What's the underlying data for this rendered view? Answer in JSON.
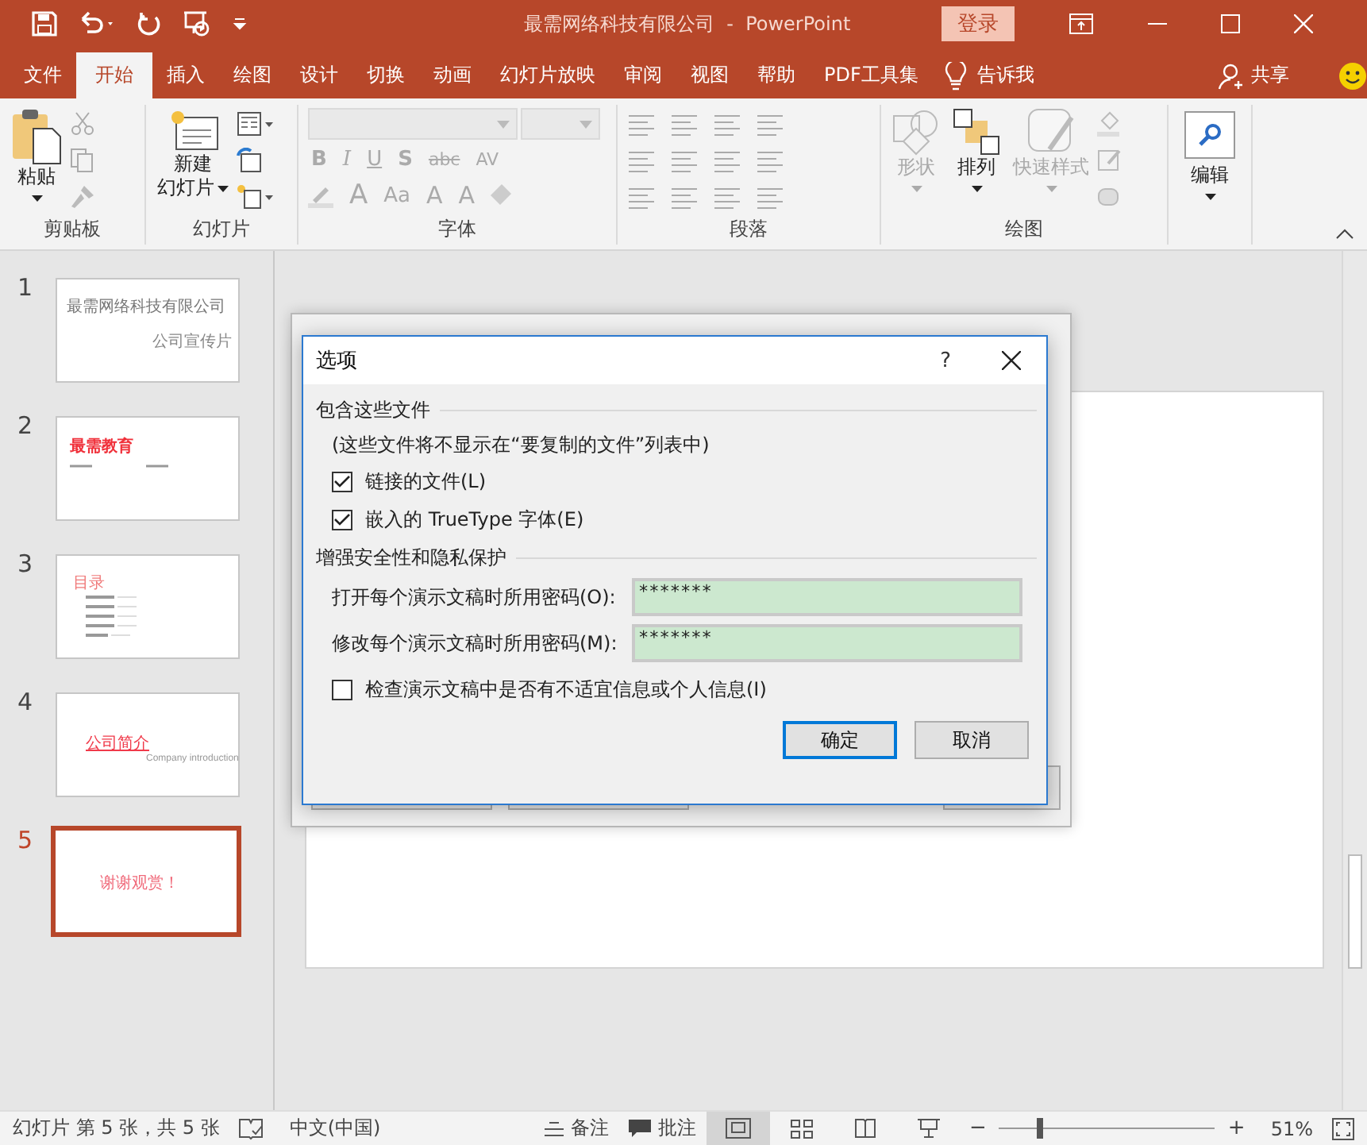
{
  "window": {
    "title": "最需网络科技有限公司  -  PowerPoint",
    "login": "登录"
  },
  "menu_tabs": [
    {
      "label": "文件",
      "selected": false
    },
    {
      "label": "开始",
      "selected": true
    },
    {
      "label": "插入",
      "selected": false
    },
    {
      "label": "绘图",
      "selected": false
    },
    {
      "label": "设计",
      "selected": false
    },
    {
      "label": "切换",
      "selected": false
    },
    {
      "label": "动画",
      "selected": false
    },
    {
      "label": "幻灯片放映",
      "selected": false
    },
    {
      "label": "审阅",
      "selected": false
    },
    {
      "label": "视图",
      "selected": false
    },
    {
      "label": "帮助",
      "selected": false
    },
    {
      "label": "PDF工具集",
      "selected": false
    }
  ],
  "tell_me": "告诉我",
  "share": "共享",
  "ribbon": {
    "clipboard": {
      "label": "剪贴板",
      "button": {
        "label": "粘贴",
        "disabled": false
      }
    },
    "slides": {
      "label": "幻灯片",
      "button": {
        "label_lines": [
          "新建",
          "幻灯片"
        ],
        "disabled": false
      }
    },
    "font": {
      "label": "字体",
      "buttons": [
        "B",
        "I",
        "U",
        "S",
        "abc",
        "AV"
      ],
      "size_buttons": [
        "A",
        "Aa",
        "A",
        "A"
      ]
    },
    "paragraph": {
      "label": "段落"
    },
    "drawing": {
      "label": "绘图",
      "buttons": [
        {
          "kind": "shapes",
          "label": "形状",
          "disabled": true
        },
        {
          "kind": "arrange",
          "label": "排列",
          "disabled": false
        },
        {
          "kind": "styles",
          "label": "快速样式",
          "disabled": true
        }
      ]
    },
    "editing": {
      "button": {
        "label": "编辑",
        "disabled": false
      }
    }
  },
  "slides": [
    {
      "number": "1",
      "selected": false,
      "kind": "title",
      "texts": [
        "最需网络科技有限公司",
        "公司宣传片"
      ]
    },
    {
      "number": "2",
      "selected": false,
      "kind": "heading",
      "texts": [
        "最需教育"
      ]
    },
    {
      "number": "3",
      "selected": false,
      "kind": "contents",
      "texts": [
        "目录"
      ]
    },
    {
      "number": "4",
      "selected": false,
      "kind": "section",
      "texts": [
        "公司简介",
        "Company  introduction"
      ]
    },
    {
      "number": "5",
      "selected": true,
      "kind": "end",
      "texts": [
        "谢谢观赏！"
      ]
    }
  ],
  "dialog": {
    "title": "选项",
    "help": "?",
    "section_1": "包含这些文件",
    "note": "(这些文件将不显示在“要复制的文件”列表中)",
    "options": [
      {
        "label": "链接的文件(L)",
        "checked": true
      },
      {
        "label": "嵌入的 TrueType 字体(E)",
        "checked": true
      }
    ],
    "section_2": "增强安全性和隐私保护",
    "fields": [
      {
        "label": "打开每个演示文稿时所用密码(O):",
        "value": "*******"
      },
      {
        "label": "修改每个演示文稿时所用密码(M):",
        "value": "*******"
      }
    ],
    "check": {
      "label": "检查演示文稿中是否有不适宜信息或个人信息(I)",
      "checked": false
    },
    "buttons": [
      {
        "label": "确定",
        "default": true
      },
      {
        "label": "取消",
        "default": false
      }
    ]
  },
  "status_bar": {
    "slide_info": "幻灯片 第 5 张，共 5 张",
    "language": "中文(中国)",
    "notes": "备注",
    "comments": "批注",
    "views": [
      {
        "selected": true
      },
      {
        "selected": false
      },
      {
        "selected": false
      },
      {
        "selected": false
      }
    ],
    "zoom_out": "−",
    "zoom_in": "+",
    "zoom": {
      "level": 0.17
    },
    "zoom_label": "51%"
  }
}
